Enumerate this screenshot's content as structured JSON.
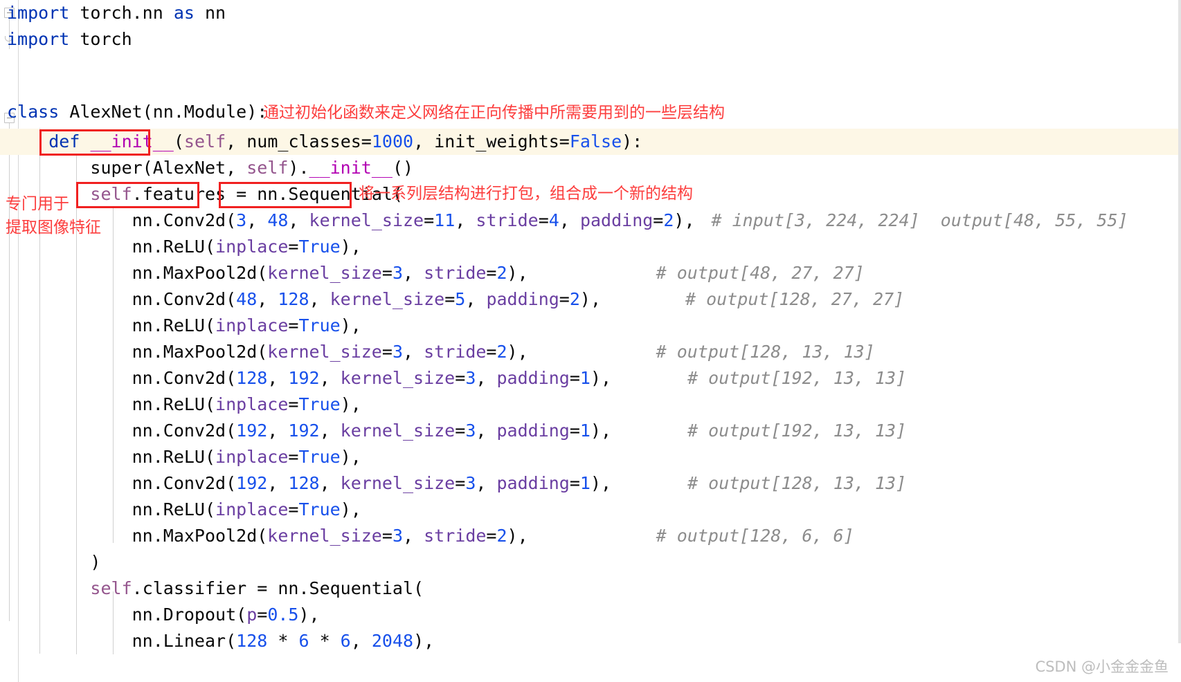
{
  "editor": {
    "app": "pycharm-code-editor",
    "language": "python",
    "theme": "light",
    "font_size_px": 25,
    "line_height_px": 38,
    "colors": {
      "background": "#ffffff",
      "text": "#080808",
      "keyword": "#0033b3",
      "number": "#1750eb",
      "self": "#94558d",
      "magic_method": "#b200b2",
      "keyword_argument": "#6a3ea1",
      "comment": "#8c8c8c",
      "annotation_red": "#fc3d3d",
      "box_red": "#f02020",
      "current_line_highlight": "#fdf7e6",
      "gutter_rule": "#d6d6d6",
      "indent_guide": "#d0d0d0",
      "watermark": "#bdbdbd"
    }
  },
  "code_lines": [
    {
      "indent": 0,
      "text": "import torch.nn as nn"
    },
    {
      "indent": 0,
      "text": "import torch"
    },
    {
      "indent": 0,
      "text": ""
    },
    {
      "indent": 0,
      "text": ""
    },
    {
      "indent": 0,
      "text": "class AlexNet(nn.Module):"
    },
    {
      "indent": 1,
      "text": "def __init__(self, num_classes=1000, init_weights=False):"
    },
    {
      "indent": 2,
      "text": "super(AlexNet, self).__init__()"
    },
    {
      "indent": 2,
      "text": "self.features = nn.Sequential("
    },
    {
      "indent": 3,
      "text": "nn.Conv2d(3, 48, kernel_size=11, stride=4, padding=2),",
      "comment": "# input[3, 224, 224]  output[48, 55, 55]"
    },
    {
      "indent": 3,
      "text": "nn.ReLU(inplace=True),"
    },
    {
      "indent": 3,
      "text": "nn.MaxPool2d(kernel_size=3, stride=2),",
      "comment": "# output[48, 27, 27]"
    },
    {
      "indent": 3,
      "text": "nn.Conv2d(48, 128, kernel_size=5, padding=2),",
      "comment": "# output[128, 27, 27]"
    },
    {
      "indent": 3,
      "text": "nn.ReLU(inplace=True),"
    },
    {
      "indent": 3,
      "text": "nn.MaxPool2d(kernel_size=3, stride=2),",
      "comment": "# output[128, 13, 13]"
    },
    {
      "indent": 3,
      "text": "nn.Conv2d(128, 192, kernel_size=3, padding=1),",
      "comment": "# output[192, 13, 13]"
    },
    {
      "indent": 3,
      "text": "nn.ReLU(inplace=True),"
    },
    {
      "indent": 3,
      "text": "nn.Conv2d(192, 192, kernel_size=3, padding=1),",
      "comment": "# output[192, 13, 13]"
    },
    {
      "indent": 3,
      "text": "nn.ReLU(inplace=True),"
    },
    {
      "indent": 3,
      "text": "nn.Conv2d(192, 128, kernel_size=3, padding=1),",
      "comment": "# output[128, 13, 13]"
    },
    {
      "indent": 3,
      "text": "nn.ReLU(inplace=True),"
    },
    {
      "indent": 3,
      "text": "nn.MaxPool2d(kernel_size=3, stride=2),",
      "comment": "# output[128, 6, 6]"
    },
    {
      "indent": 2,
      "text": ")"
    },
    {
      "indent": 2,
      "text": "self.classifier = nn.Sequential("
    },
    {
      "indent": 3,
      "text": "nn.Dropout(p=0.5),"
    },
    {
      "indent": 3,
      "text": "nn.Linear(128 * 6 * 6, 2048),"
    }
  ],
  "lines": {
    "l1": {
      "kw1": "import",
      "m1": " torch.nn ",
      "kw2": "as",
      "m2": " nn"
    },
    "l2": {
      "kw1": "import",
      "m1": " torch"
    },
    "l5": {
      "kw": "class",
      "rest": " AlexNet(nn.Module):"
    },
    "l6": {
      "kw": "def",
      "sp": " ",
      "magic": "__init__",
      "p1": "(",
      "self": "self",
      "p2": ", num_classes=",
      "n1": "1000",
      "p3": ", init_weights=",
      "b1": "False",
      "p4": "):"
    },
    "l7": {
      "a": "super(AlexNet, ",
      "self": "self",
      "b": ").",
      "magic": "__init__",
      "c": "()"
    },
    "l8": {
      "self": "self",
      "a": ".features = nn.Sequential("
    },
    "l9": {
      "a": "nn.Conv2d(",
      "n1": "3",
      "b": ", ",
      "n2": "48",
      "c": ", ",
      "p1": "kernel_size",
      "d": "=",
      "n3": "11",
      "e": ", ",
      "p2": "stride",
      "f": "=",
      "n4": "4",
      "g": ", ",
      "p3": "padding",
      "h": "=",
      "n5": "2",
      "i": "),",
      "comment": "# input[3, 224, 224]  output[48, 55, 55]"
    },
    "l10": {
      "a": "nn.ReLU(",
      "p1": "inplace",
      "b": "=",
      "b1": "True",
      "c": "),"
    },
    "l11": {
      "a": "nn.MaxPool2d(",
      "p1": "kernel_size",
      "b": "=",
      "n1": "3",
      "c": ", ",
      "p2": "stride",
      "d": "=",
      "n2": "2",
      "e": "),",
      "comment": "# output[48, 27, 27]"
    },
    "l12": {
      "a": "nn.Conv2d(",
      "n1": "48",
      "b": ", ",
      "n2": "128",
      "c": ", ",
      "p1": "kernel_size",
      "d": "=",
      "n3": "5",
      "e": ", ",
      "p2": "padding",
      "f": "=",
      "n4": "2",
      "g": "),",
      "comment": "# output[128, 27, 27]"
    },
    "l13": {
      "a": "nn.ReLU(",
      "p1": "inplace",
      "b": "=",
      "b1": "True",
      "c": "),"
    },
    "l14": {
      "a": "nn.MaxPool2d(",
      "p1": "kernel_size",
      "b": "=",
      "n1": "3",
      "c": ", ",
      "p2": "stride",
      "d": "=",
      "n2": "2",
      "e": "),",
      "comment": "# output[128, 13, 13]"
    },
    "l15": {
      "a": "nn.Conv2d(",
      "n1": "128",
      "b": ", ",
      "n2": "192",
      "c": ", ",
      "p1": "kernel_size",
      "d": "=",
      "n3": "3",
      "e": ", ",
      "p2": "padding",
      "f": "=",
      "n4": "1",
      "g": "),",
      "comment": "# output[192, 13, 13]"
    },
    "l16": {
      "a": "nn.ReLU(",
      "p1": "inplace",
      "b": "=",
      "b1": "True",
      "c": "),"
    },
    "l17": {
      "a": "nn.Conv2d(",
      "n1": "192",
      "b": ", ",
      "n2": "192",
      "c": ", ",
      "p1": "kernel_size",
      "d": "=",
      "n3": "3",
      "e": ", ",
      "p2": "padding",
      "f": "=",
      "n4": "1",
      "g": "),",
      "comment": "# output[192, 13, 13]"
    },
    "l18": {
      "a": "nn.ReLU(",
      "p1": "inplace",
      "b": "=",
      "b1": "True",
      "c": "),"
    },
    "l19": {
      "a": "nn.Conv2d(",
      "n1": "192",
      "b": ", ",
      "n2": "128",
      "c": ", ",
      "p1": "kernel_size",
      "d": "=",
      "n3": "3",
      "e": ", ",
      "p2": "padding",
      "f": "=",
      "n4": "1",
      "g": "),",
      "comment": "# output[128, 13, 13]"
    },
    "l20": {
      "a": "nn.ReLU(",
      "p1": "inplace",
      "b": "=",
      "b1": "True",
      "c": "),"
    },
    "l21": {
      "a": "nn.MaxPool2d(",
      "p1": "kernel_size",
      "b": "=",
      "n1": "3",
      "c": ", ",
      "p2": "stride",
      "d": "=",
      "n2": "2",
      "e": "),",
      "comment": "# output[128, 6, 6]"
    },
    "l22": {
      "a": ")"
    },
    "l23": {
      "self": "self",
      "a": ".classifier = nn.Sequential("
    },
    "l24": {
      "a": "nn.Dropout(",
      "p1": "p",
      "b": "=",
      "n1": "0.5",
      "c": "),"
    },
    "l25": {
      "a": "nn.Linear(",
      "n1": "128",
      "b": " * ",
      "n2": "6",
      "c": " * ",
      "n3": "6",
      "d": ", ",
      "n4": "2048",
      "e": "),"
    }
  },
  "annotations": [
    {
      "id": "anno_init",
      "text": "通过初始化函数来定义网络在正向传播中所需要用到的一些层结构"
    },
    {
      "id": "anno_sequential",
      "text": "将一系列层结构进行打包，组合成一个新的结构"
    },
    {
      "id": "anno_features_l1",
      "text": "专门用于"
    },
    {
      "id": "anno_features_l2",
      "text": "提取图像特征"
    }
  ],
  "highlight_boxes": [
    {
      "id": "box_init",
      "label": "def __init__"
    },
    {
      "id": "box_features",
      "label": "self.features"
    },
    {
      "id": "box_sequential",
      "label": "nn.Sequential("
    }
  ],
  "watermark": {
    "text": "CSDN @小金金金鱼"
  }
}
